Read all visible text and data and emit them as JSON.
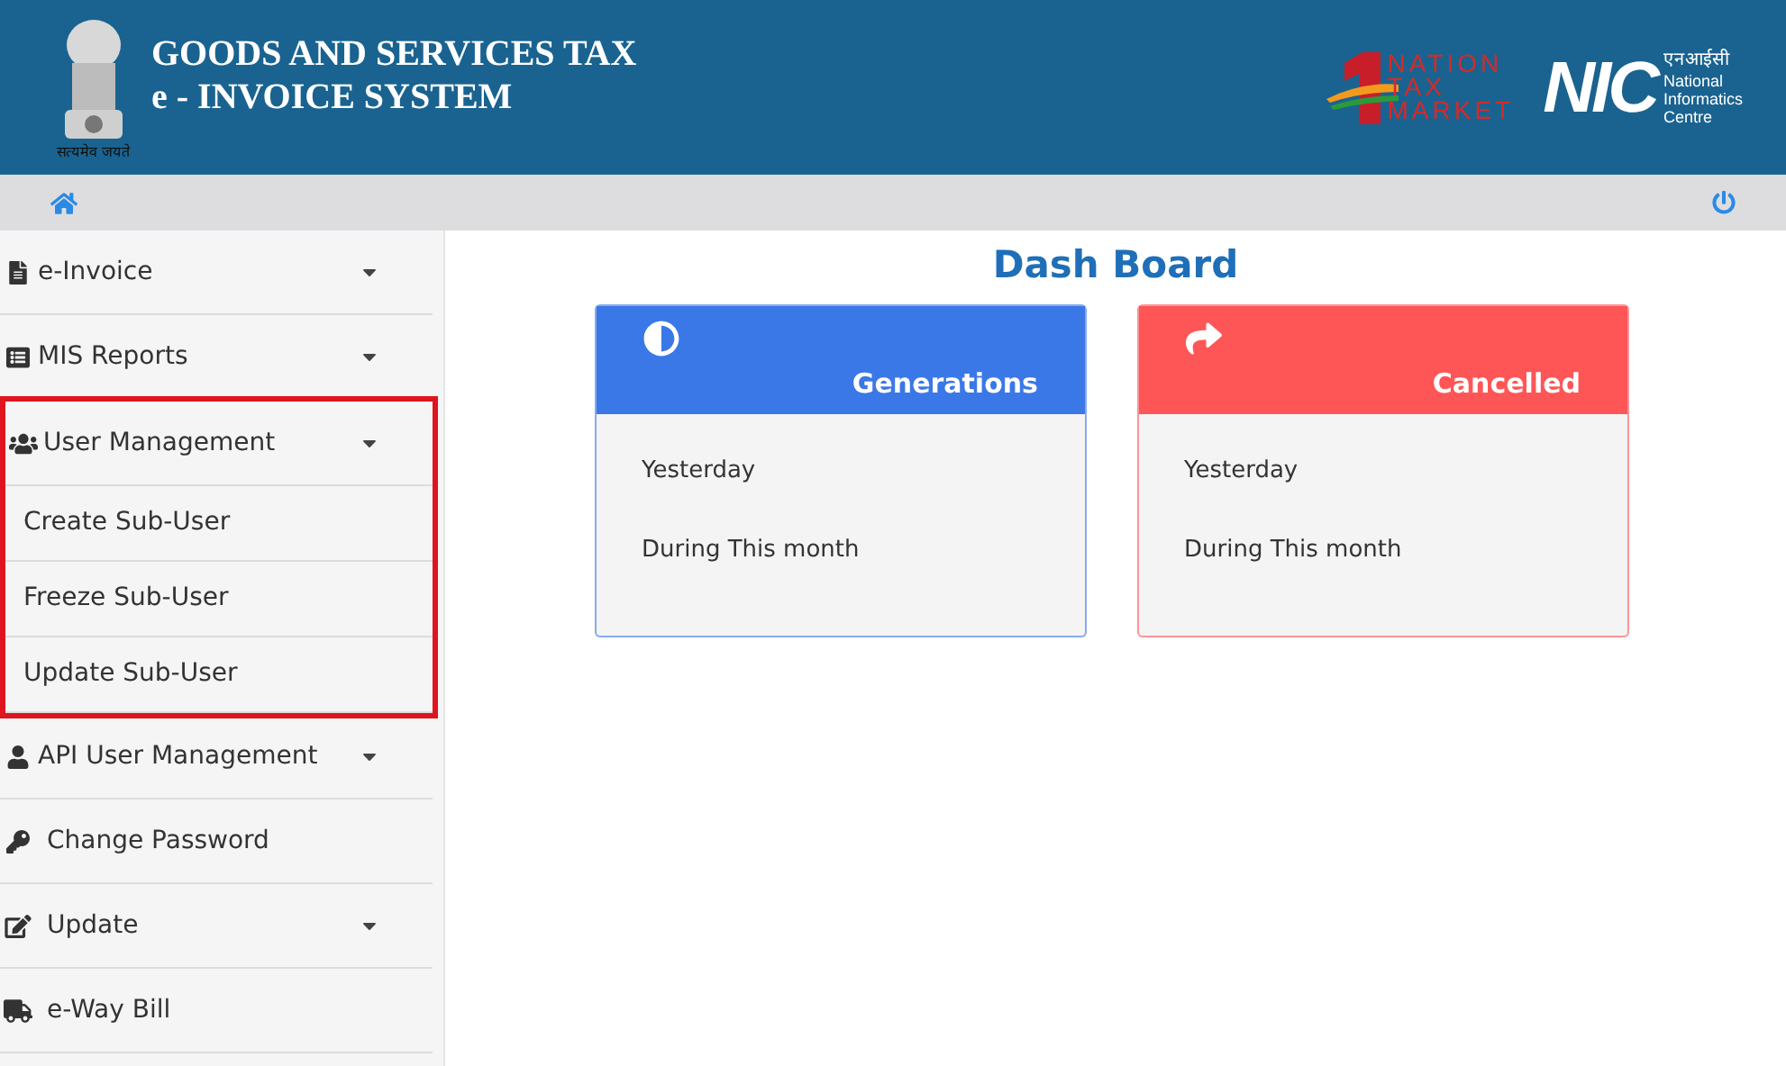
{
  "header": {
    "title_line1": "GOODS AND SERVICES TAX",
    "title_line2": "e - INVOICE SYSTEM",
    "emblem_motto": "सत्यमेव जयते",
    "logo1": [
      "NATION",
      "TAX",
      "MARKET"
    ],
    "logo2": {
      "mark": "NIC",
      "hindi": "एनआईसी",
      "lines": [
        "National",
        "Informatics",
        "Centre"
      ]
    }
  },
  "sidebar": {
    "items": [
      {
        "label": "e-Invoice",
        "dropdown": true,
        "highlighted": false
      },
      {
        "label": "MIS Reports",
        "dropdown": true,
        "highlighted": false
      },
      {
        "label": "User Management",
        "dropdown": true,
        "highlighted": true,
        "children": [
          {
            "label": "Create Sub-User"
          },
          {
            "label": "Freeze Sub-User"
          },
          {
            "label": "Update Sub-User"
          }
        ]
      },
      {
        "label": "API User Management",
        "dropdown": true,
        "highlighted": false
      },
      {
        "label": "Change Password",
        "dropdown": false,
        "highlighted": false
      },
      {
        "label": "Update",
        "dropdown": true,
        "highlighted": false
      },
      {
        "label": "e-Way Bill",
        "dropdown": false,
        "highlighted": false
      }
    ]
  },
  "dashboard": {
    "title": "Dash Board",
    "cards": [
      {
        "kind": "generations",
        "title": "Generations",
        "color": "#3b78e7",
        "rows": [
          "Yesterday",
          "During This month"
        ]
      },
      {
        "kind": "cancelled",
        "title": "Cancelled",
        "color": "#fe5656",
        "rows": [
          "Yesterday",
          "During This month"
        ]
      }
    ]
  }
}
